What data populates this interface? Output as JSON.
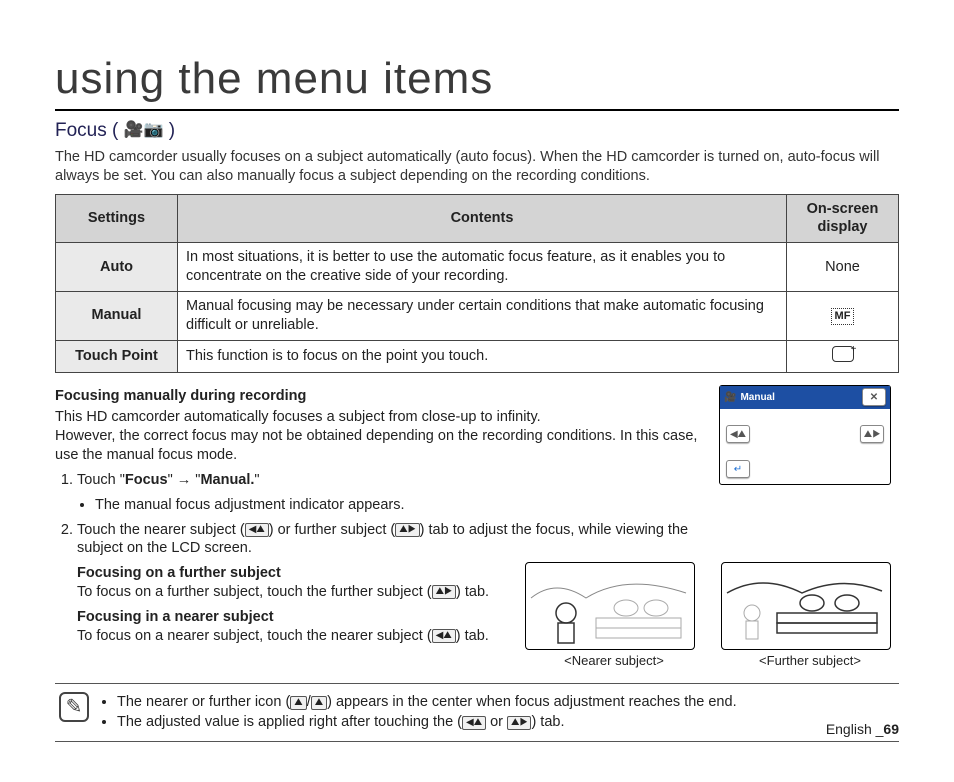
{
  "page_title": "using the menu items",
  "section": {
    "title": "Focus (",
    "title_icons": "🎥📷",
    "title_close": ")",
    "intro": "The HD camcorder usually focuses on a subject automatically (auto focus). When the HD camcorder is turned on, auto-focus will always be set. You can also manually focus a subject depending on the recording conditions."
  },
  "table": {
    "headers": {
      "col1": "Settings",
      "col2": "Contents",
      "col3": "On-screen display"
    },
    "rows": [
      {
        "label": "Auto",
        "content": "In most situations, it is better to use the automatic focus feature, as it enables you to concentrate on the creative side of your recording.",
        "osd": "None",
        "osd_is_text": true
      },
      {
        "label": "Manual",
        "content": "Manual focusing may be necessary under certain conditions that make automatic focusing difficult or unreliable.",
        "osd_icon": "mf-icon"
      },
      {
        "label": "Touch Point",
        "content": "This function is to focus on the point you touch.",
        "osd_icon": "touchpoint-icon"
      }
    ]
  },
  "manual_focus": {
    "heading": "Focusing manually during recording",
    "desc1": "This HD camcorder automatically focuses a subject from close-up to infinity.",
    "desc2": "However, the correct focus may not be obtained depending on the recording conditions. In this case, use the manual focus mode.",
    "steps": [
      {
        "text_pre": "Touch \"",
        "bold1": "Focus",
        "text_mid": "\" → \"",
        "bold2": "Manual.",
        "text_post": "\"",
        "bullets": [
          "The manual focus adjustment indicator appears."
        ]
      },
      {
        "full1_a": "Touch the nearer subject (",
        "full1_b": ") or further subject (",
        "full1_c": ") tab to adjust the focus, while viewing the subject on the LCD screen.",
        "sub": [
          {
            "title": "Focusing on a further subject",
            "text_a": "To focus on a further subject, touch the further subject (",
            "text_b": ") tab."
          },
          {
            "title": "Focusing in a nearer subject",
            "text_a": "To focus on a nearer subject, touch the nearer subject (",
            "text_b": ") tab."
          }
        ]
      }
    ]
  },
  "lcd": {
    "mode_label": "Manual"
  },
  "scenes": {
    "nearer": "<Nearer subject>",
    "further": "<Further subject>"
  },
  "notes": [
    {
      "a": "The nearer or further icon (",
      "b": "/",
      "c": ") appears in the center when focus adjustment reaches the end."
    },
    {
      "a": "The adjusted value is applied right after touching the (",
      "b": " or ",
      "c": ") tab."
    }
  ],
  "footer": {
    "lang": "English ",
    "sep": "_",
    "page": "69"
  },
  "icons": {
    "nearer_tab": "◀⛰",
    "further_tab": "⛰▶",
    "nearer_solid": "⛰",
    "further_solid": "⛰"
  }
}
